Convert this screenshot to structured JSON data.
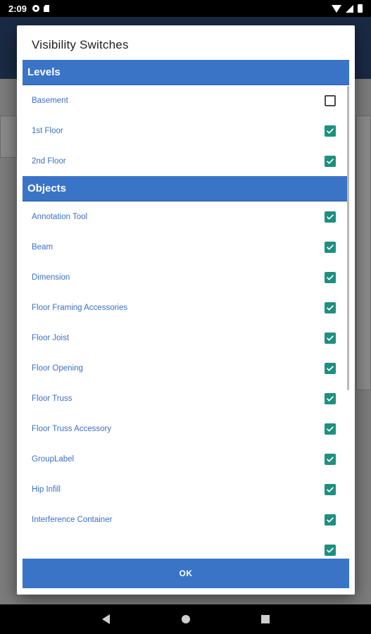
{
  "status_bar": {
    "time": "2:09",
    "icons": [
      "gear-icon",
      "sdcard-icon",
      "wifi-icon",
      "signal-icon",
      "battery-icon"
    ]
  },
  "dialog": {
    "title": "Visibility Switches",
    "sections": [
      {
        "header": "Levels",
        "items": [
          {
            "label": "Basement",
            "checked": false
          },
          {
            "label": "1st Floor",
            "checked": true
          },
          {
            "label": "2nd Floor",
            "checked": true
          }
        ]
      },
      {
        "header": "Objects",
        "items": [
          {
            "label": "Annotation Tool",
            "checked": true
          },
          {
            "label": "Beam",
            "checked": true
          },
          {
            "label": "Dimension",
            "checked": true
          },
          {
            "label": "Floor Framing Accessories",
            "checked": true
          },
          {
            "label": "Floor Joist",
            "checked": true
          },
          {
            "label": "Floor Opening",
            "checked": true
          },
          {
            "label": "Floor Truss",
            "checked": true
          },
          {
            "label": "Floor Truss Accessory",
            "checked": true
          },
          {
            "label": "GroupLabel",
            "checked": true
          },
          {
            "label": "Hip Infill",
            "checked": true
          },
          {
            "label": "Interference Container",
            "checked": true
          },
          {
            "label": "",
            "checked": true
          }
        ]
      }
    ],
    "ok_label": "OK"
  },
  "colors": {
    "accent": "#3a74c7",
    "checkbox": "#1e8f80",
    "label": "#3a6fc4"
  },
  "nav_bar": {
    "icons": [
      "back-icon",
      "home-icon",
      "recents-icon"
    ]
  }
}
